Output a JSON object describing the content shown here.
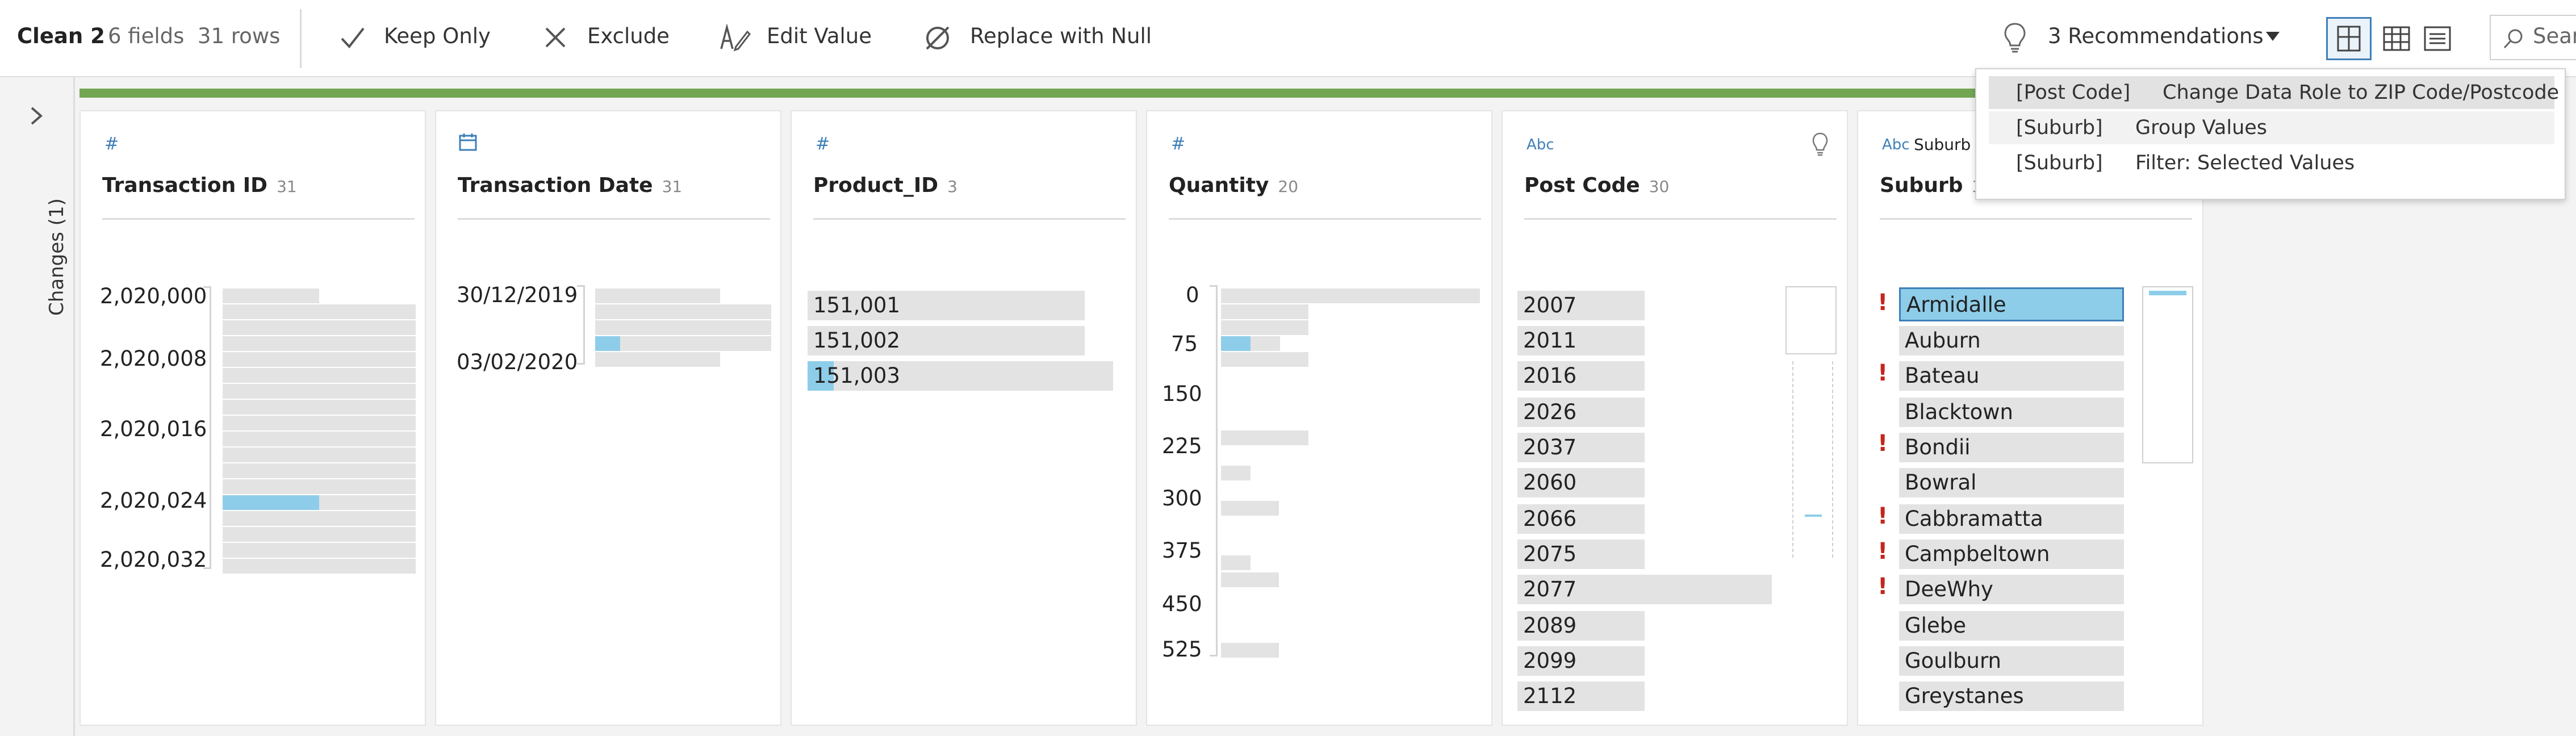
{
  "toolbar": {
    "step_name": "Clean 2",
    "summary": "6 fields  31 rows",
    "keep_only": "Keep Only",
    "exclude": "Exclude",
    "edit_value": "Edit Value",
    "replace_null": "Replace with Null",
    "recommendations": "3 Recommendations",
    "search": "Sear"
  },
  "side": {
    "changes_label": "Changes (1)"
  },
  "cards": [
    {
      "type_icon": "#",
      "name": "Transaction ID",
      "count": "31",
      "labels": [
        "2,020,000",
        "2,020,008",
        "2,020,016",
        "2,020,024",
        "2,020,032"
      ]
    },
    {
      "type_icon": "calendar-icon",
      "name": "Transaction Date",
      "count": "31",
      "labels": [
        "30/12/2019",
        "03/02/2020"
      ]
    },
    {
      "type_icon": "#",
      "name": "Product_ID",
      "count": "3",
      "values": [
        "151,001",
        "151,002",
        "151,003"
      ]
    },
    {
      "type_icon": "#",
      "name": "Quantity",
      "count": "20",
      "labels": [
        "0",
        "75",
        "150",
        "225",
        "300",
        "375",
        "450",
        "525"
      ]
    },
    {
      "type_icon": "Abc",
      "name": "Post Code",
      "count": "30",
      "values": [
        "2007",
        "2011",
        "2016",
        "2026",
        "2037",
        "2060",
        "2066",
        "2075",
        "2077",
        "2089",
        "2099",
        "2112"
      ]
    },
    {
      "type_icon": "Abc",
      "name": "Suburb",
      "count": "31",
      "values": [
        "Armidalle",
        "Auburn",
        "Bateau",
        "Blacktown",
        "Bondii",
        "Bowral",
        "Cabbramatta",
        "Campbeltown",
        "DeeWhy",
        "Glebe",
        "Goulburn",
        "Greystanes"
      ]
    }
  ],
  "recommendations": [
    {
      "column": "[Post Code]",
      "action": "Change Data Role to ZIP Code/Postcode"
    },
    {
      "column": "[Suburb]",
      "action": "Group Values"
    },
    {
      "column": "[Suburb]",
      "action": "Filter: Selected Values"
    }
  ],
  "suburb_header_peek": "Suburb",
  "colors": {
    "accent_green": "#72a653",
    "highlight_blue": "#8ecde9",
    "warning_red": "#c4261d",
    "type_blue": "#3e7fb8"
  }
}
